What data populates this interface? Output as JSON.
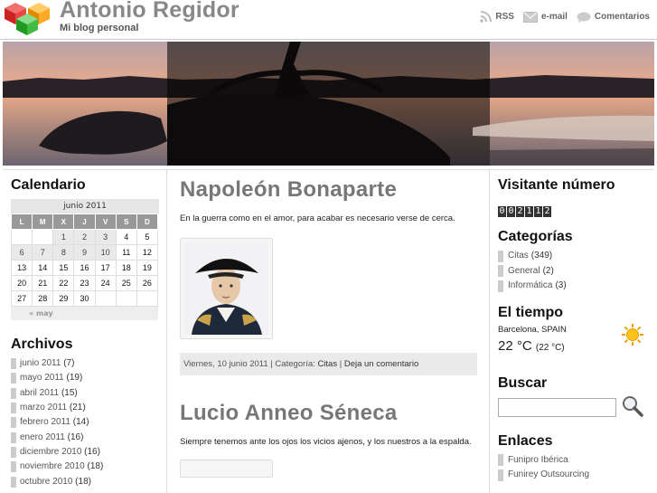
{
  "header": {
    "title": "Antonio Regidor",
    "tagline": "Mi blog personal",
    "links": [
      {
        "label": "RSS",
        "icon": "rss-icon"
      },
      {
        "label": "e-mail",
        "icon": "mail-icon"
      },
      {
        "label": "Comentarios",
        "icon": "comment-bubble-icon"
      }
    ]
  },
  "calendar": {
    "title": "Calendario",
    "caption": "junio 2011",
    "weekdays": [
      "L",
      "M",
      "X",
      "J",
      "V",
      "S",
      "D"
    ],
    "rows": [
      [
        "",
        "",
        "1",
        "2",
        "3",
        "4",
        "5"
      ],
      [
        "6",
        "7",
        "8",
        "9",
        "10",
        "11",
        "12"
      ],
      [
        "13",
        "14",
        "15",
        "16",
        "17",
        "18",
        "19"
      ],
      [
        "20",
        "21",
        "22",
        "23",
        "24",
        "25",
        "26"
      ],
      [
        "27",
        "28",
        "29",
        "30",
        "",
        "",
        ""
      ]
    ],
    "prev_link": "« may"
  },
  "archives": {
    "title": "Archivos",
    "items": [
      {
        "label": "junio 2011",
        "count": "(7)"
      },
      {
        "label": "mayo 2011",
        "count": "(19)"
      },
      {
        "label": "abril 2011",
        "count": "(15)"
      },
      {
        "label": "marzo 2011",
        "count": "(21)"
      },
      {
        "label": "febrero 2011",
        "count": "(14)"
      },
      {
        "label": "enero 2011",
        "count": "(16)"
      },
      {
        "label": "diciembre 2010",
        "count": "(16)"
      },
      {
        "label": "noviembre 2010",
        "count": "(18)"
      },
      {
        "label": "octubre 2010",
        "count": "(18)"
      }
    ]
  },
  "posts": [
    {
      "title": "Napoleón Bonaparte",
      "text": "En la guerra como en el amor, para acabar es necesario verse de cerca.",
      "meta_date": "Viernes, 10 junio 2011",
      "meta_cat_label": "Categoría:",
      "meta_cat": "Citas",
      "meta_comment": "Deja un comentario"
    },
    {
      "title": "Lucio Anneo Séneca",
      "text": "Siempre tenemos ante los ojos los vicios ajenos, y los nuestros a la espalda."
    }
  ],
  "visitors": {
    "title": "Visitante número",
    "digits": [
      "0",
      "0",
      "2",
      "1",
      "1",
      "2"
    ]
  },
  "categories": {
    "title": "Categorías",
    "items": [
      {
        "label": "Citas",
        "count": "(349)"
      },
      {
        "label": "General",
        "count": "(2)"
      },
      {
        "label": "Informática",
        "count": "(3)"
      }
    ]
  },
  "weather": {
    "title": "El tiempo",
    "location": "Barcelona, SPAIN",
    "temp": "22 °C",
    "feels": "(22 °C)",
    "icon": "sun-icon"
  },
  "search": {
    "title": "Buscar",
    "placeholder": "",
    "icon": "magnifier-icon"
  },
  "links": {
    "title": "Enlaces",
    "items": [
      {
        "label": "Funipro Ibérica"
      },
      {
        "label": "Funirey Outsourcing"
      }
    ]
  }
}
